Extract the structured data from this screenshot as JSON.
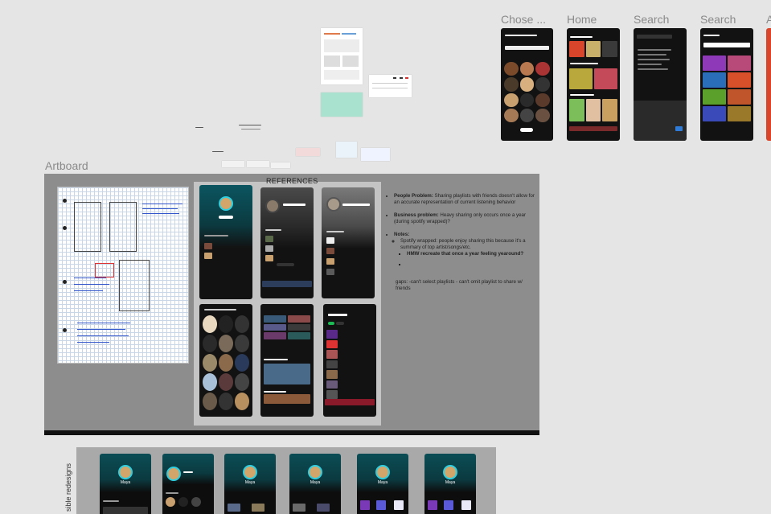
{
  "frames": {
    "labels": [
      "Chose ...",
      "Home",
      "Search",
      "Search",
      "A"
    ],
    "artboard_label": "Artboard",
    "references_title": "REFERENCES",
    "redesign_label": "sible redesigns"
  },
  "notes": {
    "people_problem_label": "People Problem:",
    "people_problem_text": " Sharing playlists with friends doesn't allow for an accurate representation of current listening behavior",
    "business_problem_label": "Business problem:",
    "business_problem_text": " Heavy sharing only occurs once a year (during spotify wrapped)?",
    "notes_label": "Notes:",
    "note_item": "Spotify wrapped: people enjoy sharing this because it's a summary of top artist/songs/etc.",
    "hmw": "HMW recreate that once a year feeling yearound?",
    "gaps": "gaps: -can't select playlists - can't omit playlist to share w/ friends"
  },
  "redesign": {
    "profile_name": "Maya"
  },
  "colors": {
    "canvas_bg": "#e5e5e5",
    "artboard_bg": "#8d8d8d",
    "spotify_dark": "#121212",
    "accent_teal": "#2ecfe0",
    "spotify_green": "#1db954"
  }
}
